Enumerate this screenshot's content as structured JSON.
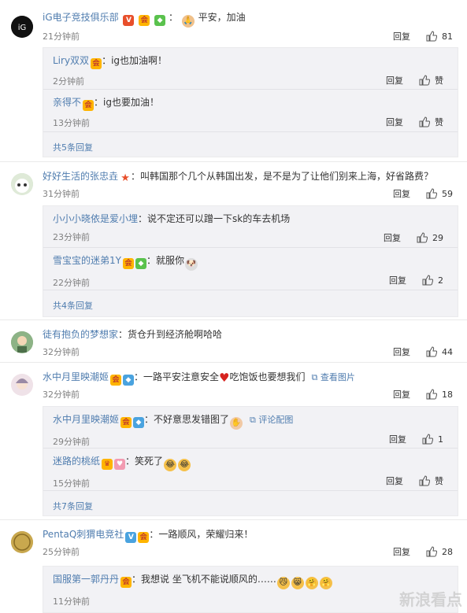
{
  "comments": [
    {
      "user": "iG电子竞技俱乐部",
      "text": "平安，加油",
      "time": "21分钟前",
      "reply": "回复",
      "likes": "81",
      "more": "共5条回复",
      "subs": [
        {
          "user": "Liry双双",
          "text": "ig也加油啊！",
          "time": "2分钟前",
          "reply": "回复",
          "likes": "赞"
        },
        {
          "user": "亲得不",
          "text": "ig也要加油！",
          "time": "13分钟前",
          "reply": "回复",
          "likes": "赞"
        }
      ]
    },
    {
      "user": "好好生活的张忠垚",
      "text": "叫韩国那个几个从韩国出发，是不是为了让他们别来上海，好省路费？",
      "time": "31分钟前",
      "reply": "回复",
      "likes": "59",
      "more": "共4条回复",
      "subs": [
        {
          "user": "小小小晓依是爱小埋",
          "text": "说不定还可以蹭一下sk的车去机场",
          "time": "23分钟前",
          "reply": "回复",
          "likes": "29"
        },
        {
          "user": "雪宝宝的迷弟1Y",
          "text": "就服你",
          "time": "22分钟前",
          "reply": "回复",
          "likes": "2"
        }
      ]
    },
    {
      "user": "徒有抱负的梦想家",
      "text": "货仓升到经济舱啊哈哈",
      "time": "32分钟前",
      "reply": "回复",
      "likes": "44"
    },
    {
      "user": "水中月里映潮姬",
      "text_a": "一路平安注意安全",
      "text_b": "吃饱饭也要想我们",
      "view_pic": "查看图片",
      "time": "32分钟前",
      "reply": "回复",
      "likes": "18",
      "more": "共7条回复",
      "subs": [
        {
          "user": "水中月里映潮姬",
          "text": "不好意思发错图了",
          "pic_link": "评论配图",
          "time": "29分钟前",
          "reply": "回复",
          "likes": "1"
        },
        {
          "user": "迷路的桃纸",
          "text": "笑死了",
          "time": "15分钟前",
          "reply": "回复",
          "likes": "赞"
        }
      ]
    },
    {
      "user": "PentaQ刺猬电竞社",
      "text": "一路顺风，荣耀归来！",
      "time": "25分钟前",
      "reply": "回复",
      "likes": "28",
      "subs": [
        {
          "user": "国服第一郭丹丹",
          "text": "我想说 坐飞机不能说顺风的……",
          "time": "11分钟前"
        }
      ]
    }
  ],
  "watermark": "新浪看点",
  "colors": {
    "accent": "#eb7350",
    "link": "#507daf",
    "subbg": "#f2f2f5"
  }
}
